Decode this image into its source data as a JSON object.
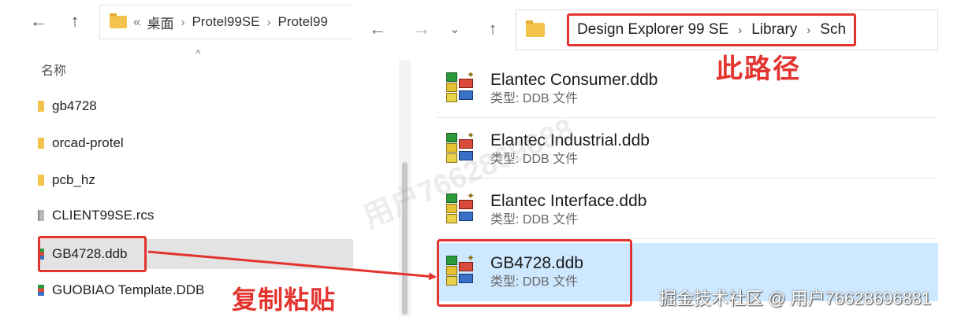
{
  "left_pane": {
    "nav": {
      "back_glyph": "←",
      "up_glyph": "↑"
    },
    "address": {
      "prefix_glyph": "«",
      "crumbs": [
        "桌面",
        "Protel99SE",
        "Protel99"
      ],
      "separator": "›"
    },
    "sort_glyph": "^",
    "column_header": "名称",
    "items": [
      {
        "name": "gb4728",
        "kind": "folder"
      },
      {
        "name": "orcad-protel",
        "kind": "folder"
      },
      {
        "name": "pcb_hz",
        "kind": "folder"
      },
      {
        "name": "CLIENT99SE.rcs",
        "kind": "file"
      },
      {
        "name": "GB4728.ddb",
        "kind": "ddb",
        "selected": true
      },
      {
        "name": "GUOBIAO Template.DDB",
        "kind": "ddb"
      }
    ]
  },
  "right_pane": {
    "nav": {
      "back_glyph": "←",
      "forward_glyph": "→",
      "recent_glyph": "⌄",
      "up_glyph": "↑"
    },
    "address": {
      "crumbs": [
        "Design Explorer 99 SE",
        "Library",
        "Sch"
      ],
      "separator": "›"
    },
    "files": [
      {
        "name": "Elantec Consumer.ddb",
        "type": "类型: DDB 文件"
      },
      {
        "name": "Elantec Industrial.ddb",
        "type": "类型: DDB 文件"
      },
      {
        "name": "Elantec Interface.ddb",
        "type": "类型: DDB 文件"
      },
      {
        "name": "GB4728.ddb",
        "type": "类型: DDB 文件",
        "selected": true
      }
    ]
  },
  "annotations": {
    "path_label": "此路径",
    "copy_label": "复制粘贴",
    "color": "#e3342f"
  },
  "watermark": "用户7662869688",
  "credit": "掘金技术社区 @ 用户76628696881"
}
